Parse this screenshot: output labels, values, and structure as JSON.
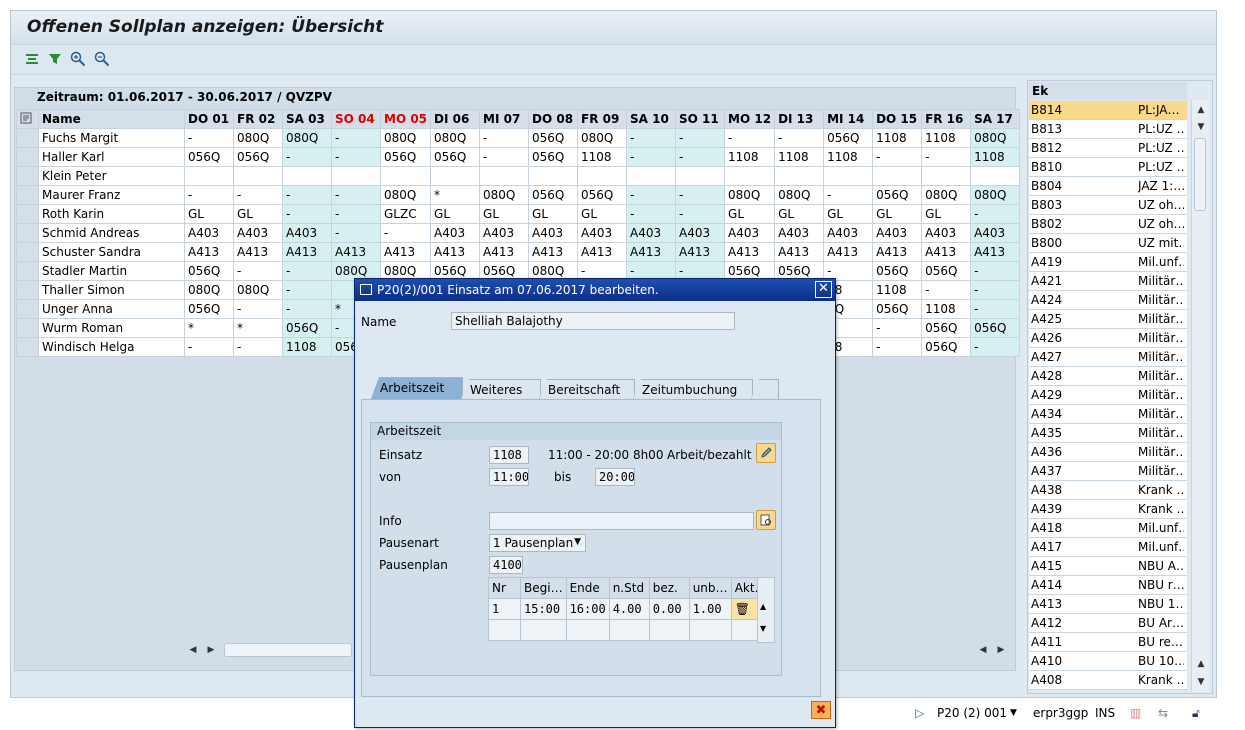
{
  "app": {
    "title": "Offenen Sollplan anzeigen: Übersicht"
  },
  "toolbar": {
    "icons": [
      "expand-all-icon",
      "filter-icon",
      "zoom-in-icon",
      "zoom-out-icon"
    ]
  },
  "grid": {
    "period": "Zeitraum: 01.06.2017 - 30.06.2017 / QVZPV",
    "name_header": "Name",
    "days": [
      "DO 01",
      "FR 02",
      "SA 03",
      "SO 04",
      "MO 05",
      "DI 06",
      "MI 07",
      "DO 08",
      "FR 09",
      "SA 10",
      "SO 11",
      "MO 12",
      "DI 13",
      "MI 14",
      "DO 15",
      "FR 16",
      "SA 17"
    ],
    "red_days": [
      3,
      4
    ],
    "rows": [
      {
        "name": "Fuchs Margit",
        "cells": [
          "-",
          "080Q",
          "080Q",
          "-",
          "080Q",
          "080Q",
          "-",
          "056Q",
          "080Q",
          "-",
          "-",
          "-",
          "-",
          "056Q",
          "1108",
          "1108",
          "080Q"
        ]
      },
      {
        "name": "Haller Karl",
        "cells": [
          "056Q",
          "056Q",
          "-",
          "-",
          "056Q",
          "056Q",
          "-",
          "056Q",
          "1108",
          "-",
          "-",
          "1108",
          "1108",
          "1108",
          "-",
          "-",
          "1108"
        ]
      },
      {
        "name": "Klein Peter",
        "cells": [
          "",
          "",
          "",
          "",
          "",
          "",
          "",
          "",
          "",
          "",
          "",
          "",
          "",
          "",
          "",
          "",
          ""
        ]
      },
      {
        "name": "Maurer Franz",
        "cells": [
          "-",
          "-",
          "-",
          "-",
          "080Q",
          "*",
          "080Q",
          "056Q",
          "056Q",
          "-",
          "-",
          "080Q",
          "080Q",
          "-",
          "056Q",
          "080Q",
          "080Q"
        ]
      },
      {
        "name": "Roth Karin",
        "cells": [
          "GL",
          "GL",
          "-",
          "-",
          "GLZC",
          "GL",
          "GL",
          "GL",
          "GL",
          "-",
          "-",
          "GL",
          "GL",
          "GL",
          "GL",
          "GL",
          "-"
        ]
      },
      {
        "name": "Schmid Andreas",
        "cells": [
          "A403",
          "A403",
          "A403",
          "-",
          "-",
          "A403",
          "A403",
          "A403",
          "A403",
          "A403",
          "A403",
          "A403",
          "A403",
          "A403",
          "A403",
          "A403",
          "A403"
        ]
      },
      {
        "name": "Schuster Sandra",
        "cells": [
          "A413",
          "A413",
          "A413",
          "A413",
          "A413",
          "A413",
          "A413",
          "A413",
          "A413",
          "A413",
          "A413",
          "A413",
          "A413",
          "A413",
          "A413",
          "A413",
          "A413"
        ]
      },
      {
        "name": "Stadler Martin",
        "cells": [
          "056Q",
          "-",
          "-",
          "080Q",
          "080Q",
          "056Q",
          "056Q",
          "080Q",
          "-",
          "-",
          "-",
          "056Q",
          "056Q",
          "-",
          "056Q",
          "056Q",
          "-"
        ]
      },
      {
        "name": "Thaller Simon",
        "cells": [
          "080Q",
          "080Q",
          "-",
          "",
          "",
          "",
          "",
          "",
          "",
          "",
          "",
          "",
          "",
          "08",
          "1108",
          "-",
          "-"
        ]
      },
      {
        "name": "Unger Anna",
        "cells": [
          "056Q",
          "-",
          "-",
          "*",
          "",
          "",
          "",
          "",
          "",
          "",
          "",
          "",
          "",
          "6Q",
          "056Q",
          "1108",
          "-"
        ]
      },
      {
        "name": "Wurm Roman",
        "cells": [
          "*",
          "*",
          "056Q",
          "-",
          "",
          "",
          "",
          "",
          "",
          "",
          "",
          "",
          "",
          "",
          "-",
          "056Q",
          "056Q"
        ]
      },
      {
        "name": "Windisch Helga",
        "cells": [
          "-",
          "-",
          "1108",
          "056",
          "",
          "",
          "",
          "",
          "",
          "",
          "",
          "",
          "",
          "08",
          "-",
          "056Q",
          "-"
        ]
      }
    ]
  },
  "right_panel": {
    "header": "Ek",
    "items": [
      {
        "code": "B814",
        "desc": "PL:JA…"
      },
      {
        "code": "B813",
        "desc": "PL:UZ …"
      },
      {
        "code": "B812",
        "desc": "PL:UZ …"
      },
      {
        "code": "B810",
        "desc": "PL:UZ …"
      },
      {
        "code": "B804",
        "desc": "JAZ 1:…"
      },
      {
        "code": "B803",
        "desc": "UZ oh…"
      },
      {
        "code": "B802",
        "desc": "UZ oh…"
      },
      {
        "code": "B800",
        "desc": "UZ mit…"
      },
      {
        "code": "A419",
        "desc": "Mil.unf…"
      },
      {
        "code": "A421",
        "desc": "Militär…"
      },
      {
        "code": "A424",
        "desc": "Militär…"
      },
      {
        "code": "A425",
        "desc": "Militär…"
      },
      {
        "code": "A426",
        "desc": "Militär…"
      },
      {
        "code": "A427",
        "desc": "Militär…"
      },
      {
        "code": "A428",
        "desc": "Militär…"
      },
      {
        "code": "A429",
        "desc": "Militär…"
      },
      {
        "code": "A434",
        "desc": "Militär…"
      },
      {
        "code": "A435",
        "desc": "Militär…"
      },
      {
        "code": "A436",
        "desc": "Militär…"
      },
      {
        "code": "A437",
        "desc": "Militär…"
      },
      {
        "code": "A438",
        "desc": "Krank …"
      },
      {
        "code": "A439",
        "desc": "Krank …"
      },
      {
        "code": "A418",
        "desc": "Mil.unf…"
      },
      {
        "code": "A417",
        "desc": "Mil.unf…"
      },
      {
        "code": "A415",
        "desc": "NBU A…"
      },
      {
        "code": "A414",
        "desc": "NBU r…"
      },
      {
        "code": "A413",
        "desc": "NBU 1…"
      },
      {
        "code": "A412",
        "desc": "BU Ar…"
      },
      {
        "code": "A411",
        "desc": "BU re…"
      },
      {
        "code": "A410",
        "desc": "BU 10…"
      },
      {
        "code": "A408",
        "desc": "Krank …"
      }
    ]
  },
  "status": {
    "session": "P20 (2) 001",
    "server": "erpr3ggp",
    "mode": "INS"
  },
  "dialog": {
    "title": "P20(2)/001 Einsatz am 07.06.2017 bearbeiten.",
    "name_label": "Name",
    "name_value": "Shelliah Balajothy",
    "tabs": [
      "Arbeitszeit",
      "Weiteres",
      "Bereitschaft",
      "Zeitumbuchung"
    ],
    "group_title": "Arbeitszeit",
    "einsatz_label": "Einsatz",
    "einsatz_value": "1108",
    "einsatz_desc": "11:00 - 20:00 8h00",
    "einsatz_type": "Arbeit/bezahlt",
    "von_label": "von",
    "von_value": "11:00",
    "bis_label": "bis",
    "bis_value": "20:00",
    "info_label": "Info",
    "info_value": "",
    "pausenart_label": "Pausenart",
    "pausenart_value": "1 Pausenplan",
    "pausenplan_label": "Pausenplan",
    "pausenplan_value": "4100",
    "pause_headers": [
      "Nr",
      "Begi…",
      "Ende",
      "n.Std",
      "bez.",
      "unb…",
      "Akt…"
    ],
    "pause_rows": [
      [
        "1",
        "15:00",
        "16:00",
        "4.00",
        "0.00",
        "1.00"
      ]
    ]
  }
}
